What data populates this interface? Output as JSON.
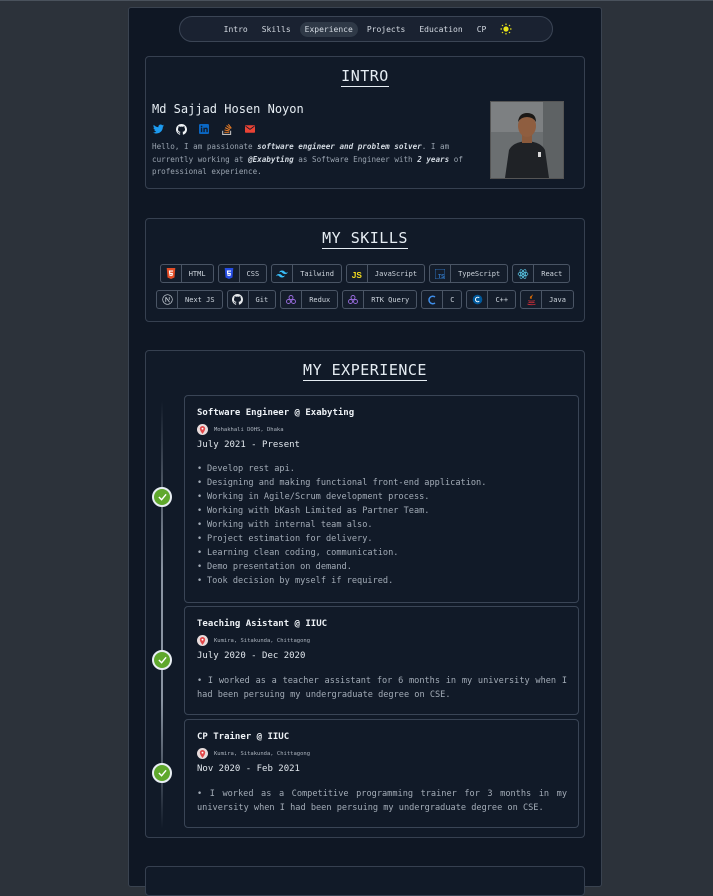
{
  "nav": {
    "items": [
      "Intro",
      "Skills",
      "Experience",
      "Projects",
      "Education",
      "CP"
    ],
    "active": "Experience",
    "theme_icon": "sun-icon"
  },
  "intro": {
    "title": "INTRO",
    "name": "Md Sajjad Hosen Noyon",
    "socials": [
      "twitter-icon",
      "github-icon",
      "linkedin-icon",
      "stackoverflow-icon",
      "mail-icon"
    ],
    "bio": {
      "p1": "Hello, I am passionate ",
      "b1": "software engineer and problem solver",
      "p2": ". I am currently working at ",
      "b2": "@Exabyting",
      "p3": " as Software Engineer with ",
      "b3": "2 years",
      "p4": " of professional experience."
    }
  },
  "skills": {
    "title": "MY SKILLS",
    "row1": [
      {
        "label": "HTML",
        "icon": "html5-icon"
      },
      {
        "label": "CSS",
        "icon": "css3-icon"
      },
      {
        "label": "Tailwind",
        "icon": "tailwind-icon"
      },
      {
        "label": "JavaScript",
        "icon": "javascript-icon"
      },
      {
        "label": "TypeScript",
        "icon": "typescript-icon"
      },
      {
        "label": "React",
        "icon": "react-icon"
      }
    ],
    "row2": [
      {
        "label": "Next JS",
        "icon": "nextjs-icon"
      },
      {
        "label": "Git",
        "icon": "git-icon"
      },
      {
        "label": "Redux",
        "icon": "redux-icon"
      },
      {
        "label": "RTK Query",
        "icon": "rtk-query-icon"
      },
      {
        "label": "C",
        "icon": "c-icon"
      },
      {
        "label": "C++",
        "icon": "cpp-icon"
      },
      {
        "label": "Java",
        "icon": "java-icon"
      }
    ]
  },
  "experience": {
    "title": "MY EXPERIENCE",
    "jobs": [
      {
        "title": "Software Engineer @ Exabyting",
        "location": "Mohakhali DOHS, Dhaka",
        "dates": "July 2021 - Present",
        "bullets": [
          "Develop rest api.",
          "Designing and making functional front-end application.",
          "Working in Agile/Scrum development process.",
          "Working with bKash Limited as Partner Team.",
          "Working with internal team also.",
          "Project estimation for delivery.",
          "Learning clean coding, communication.",
          "Demo presentation on demand.",
          "Took decision by myself if required."
        ]
      },
      {
        "title": "Teaching Asistant @ IIUC",
        "location": "Kumira, Sitakunda, Chittagong",
        "dates": "July 2020 - Dec 2020",
        "text": "•  I worked as a teacher assistant for 6 months in my university when I had been persuing my undergraduate degree on CSE."
      },
      {
        "title": "CP Trainer @ IIUC",
        "location": "Kumira, Sitakunda, Chittagong",
        "dates": "Nov 2020 - Feb 2021",
        "text": "•  I worked as a Competitive programming trainer for 3 months in my university when I had been persuing my undergraduate degree on CSE."
      }
    ]
  },
  "colors": {
    "background": "#2c323a",
    "page": "#0f1724",
    "timeline_dot": "#5fa82c"
  }
}
